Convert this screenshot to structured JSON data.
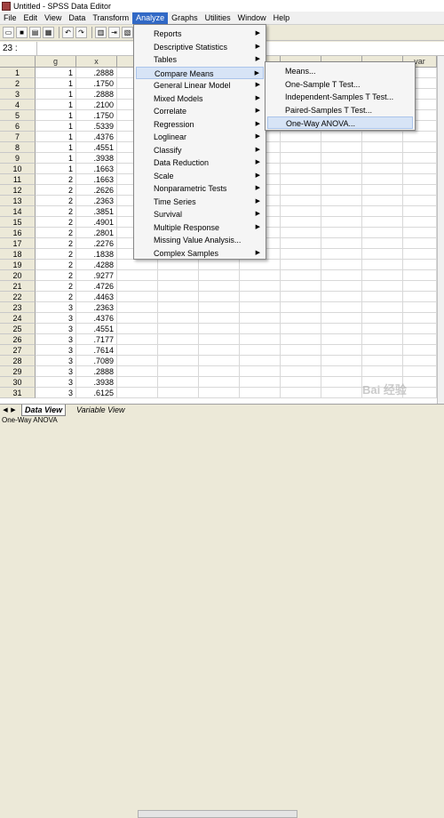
{
  "window": {
    "title": "Untitled - SPSS Data Editor"
  },
  "menubar": [
    "File",
    "Edit",
    "View",
    "Data",
    "Transform",
    "Analyze",
    "Graphs",
    "Utilities",
    "Window",
    "Help"
  ],
  "cellref": "23 :",
  "columns": {
    "g": "g",
    "x": "x",
    "var": "var"
  },
  "rows": [
    {
      "n": "1",
      "g": "1",
      "x": ".2888"
    },
    {
      "n": "2",
      "g": "1",
      "x": ".1750"
    },
    {
      "n": "3",
      "g": "1",
      "x": ".2888"
    },
    {
      "n": "4",
      "g": "1",
      "x": ".2100"
    },
    {
      "n": "5",
      "g": "1",
      "x": ".1750"
    },
    {
      "n": "6",
      "g": "1",
      "x": ".5339"
    },
    {
      "n": "7",
      "g": "1",
      "x": ".4376"
    },
    {
      "n": "8",
      "g": "1",
      "x": ".4551"
    },
    {
      "n": "9",
      "g": "1",
      "x": ".3938"
    },
    {
      "n": "10",
      "g": "1",
      "x": ".1663"
    },
    {
      "n": "11",
      "g": "2",
      "x": ".1663"
    },
    {
      "n": "12",
      "g": "2",
      "x": ".2626"
    },
    {
      "n": "13",
      "g": "2",
      "x": ".2363"
    },
    {
      "n": "14",
      "g": "2",
      "x": ".3851"
    },
    {
      "n": "15",
      "g": "2",
      "x": ".4901"
    },
    {
      "n": "16",
      "g": "2",
      "x": ".2801"
    },
    {
      "n": "17",
      "g": "2",
      "x": ".2276"
    },
    {
      "n": "18",
      "g": "2",
      "x": ".1838"
    },
    {
      "n": "19",
      "g": "2",
      "x": ".4288"
    },
    {
      "n": "20",
      "g": "2",
      "x": ".9277"
    },
    {
      "n": "21",
      "g": "2",
      "x": ".4726"
    },
    {
      "n": "22",
      "g": "2",
      "x": ".4463"
    },
    {
      "n": "23",
      "g": "3",
      "x": ".2363"
    },
    {
      "n": "24",
      "g": "3",
      "x": ".4376"
    },
    {
      "n": "25",
      "g": "3",
      "x": ".4551"
    },
    {
      "n": "26",
      "g": "3",
      "x": ".7177"
    },
    {
      "n": "27",
      "g": "3",
      "x": ".7614"
    },
    {
      "n": "28",
      "g": "3",
      "x": ".7089"
    },
    {
      "n": "29",
      "g": "3",
      "x": ".2888"
    },
    {
      "n": "30",
      "g": "3",
      "x": ".3938"
    },
    {
      "n": "31",
      "g": "3",
      "x": ".6125"
    }
  ],
  "analyze_menu": [
    {
      "label": "Reports",
      "sub": true
    },
    {
      "label": "Descriptive Statistics",
      "sub": true
    },
    {
      "label": "Tables",
      "sub": true
    },
    {
      "label": "Compare Means",
      "sub": true,
      "active": true
    },
    {
      "label": "General Linear Model",
      "sub": true
    },
    {
      "label": "Mixed Models",
      "sub": true
    },
    {
      "label": "Correlate",
      "sub": true
    },
    {
      "label": "Regression",
      "sub": true
    },
    {
      "label": "Loglinear",
      "sub": true
    },
    {
      "label": "Classify",
      "sub": true
    },
    {
      "label": "Data Reduction",
      "sub": true
    },
    {
      "label": "Scale",
      "sub": true
    },
    {
      "label": "Nonparametric Tests",
      "sub": true
    },
    {
      "label": "Time Series",
      "sub": true
    },
    {
      "label": "Survival",
      "sub": true
    },
    {
      "label": "Multiple Response",
      "sub": true
    },
    {
      "label": "Missing Value Analysis...",
      "sub": false
    },
    {
      "label": "Complex Samples",
      "sub": true
    }
  ],
  "compare_means_menu": [
    {
      "label": "Means..."
    },
    {
      "label": "One-Sample T Test..."
    },
    {
      "label": "Independent-Samples T Test..."
    },
    {
      "label": "Paired-Samples T Test..."
    },
    {
      "label": "One-Way ANOVA...",
      "active": true
    }
  ],
  "tabs": {
    "data_view": "Data View",
    "variable_view": "Variable View"
  },
  "status": "One-Way ANOVA",
  "watermark": "Bai 经验"
}
